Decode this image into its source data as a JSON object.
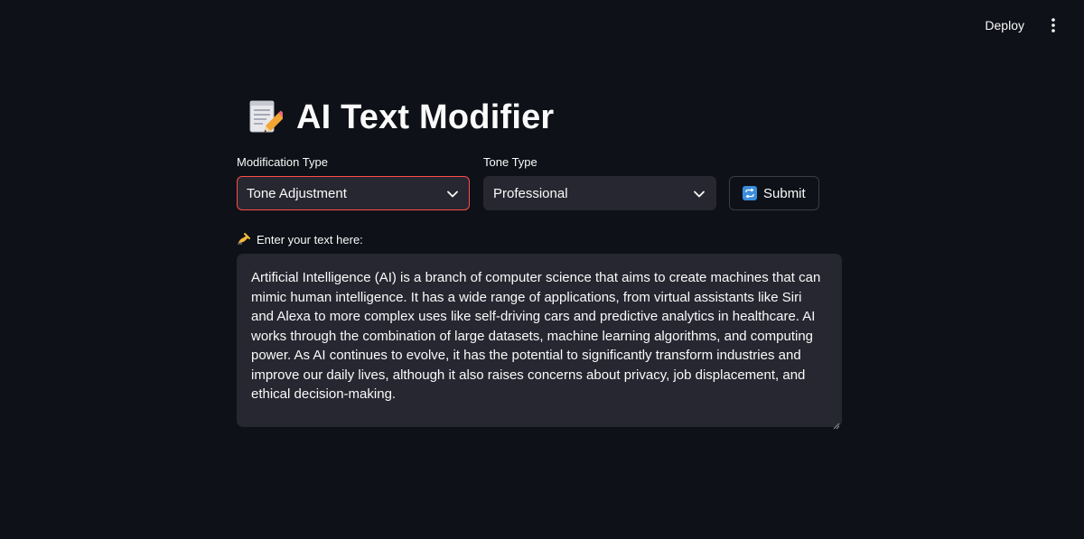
{
  "header": {
    "deploy_label": "Deploy",
    "menu_icon": "vertical-dots-icon"
  },
  "main": {
    "title_icon": "memo-pencil-icon",
    "title": "AI Text Modifier",
    "modification": {
      "label": "Modification Type",
      "selected": "Tone Adjustment"
    },
    "tone": {
      "label": "Tone Type",
      "selected": "Professional"
    },
    "submit": {
      "label": "Submit",
      "icon": "repeat-arrows-icon"
    },
    "text_input": {
      "label_icon": "writing-hand-icon",
      "label": "Enter your text here:",
      "value": "Artificial Intelligence (AI) is a branch of computer science that aims to create machines that can mimic human intelligence. It has a wide range of applications, from virtual assistants like Siri and Alexa to more complex uses like self-driving cars and predictive analytics in healthcare. AI works through the combination of large datasets, machine learning algorithms, and computing power. As AI continues to evolve, it has the potential to significantly transform industries and improve our daily lives, although it also raises concerns about privacy, job displacement, and ethical decision-making."
    }
  },
  "colors": {
    "background": "#0e1117",
    "input_background": "#262730",
    "focus_border": "#ff4b4b",
    "text": "#fafafa"
  }
}
